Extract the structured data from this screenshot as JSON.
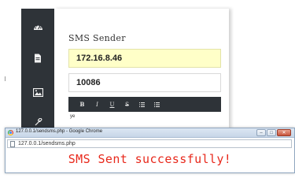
{
  "sidebar": {
    "items": [
      {
        "icon": "dashboard-icon"
      },
      {
        "icon": "document-icon"
      },
      {
        "icon": "image-icon"
      },
      {
        "icon": "link-icon"
      }
    ]
  },
  "form": {
    "title": "SMS Sender",
    "ip_value": "172.16.8.46",
    "phone_value": "10086",
    "editor_text": "ye"
  },
  "editor_toolbar": {
    "buttons": [
      {
        "label": "B",
        "icon": "bold-icon"
      },
      {
        "label": "I",
        "icon": "italic-icon"
      },
      {
        "label": "U",
        "icon": "underline-icon"
      },
      {
        "label": "S",
        "icon": "strikethrough-icon"
      },
      {
        "label": "",
        "icon": "unordered-list-icon"
      },
      {
        "label": "",
        "icon": "ordered-list-icon"
      }
    ]
  },
  "popup": {
    "window_title": "127.0.0.1/sendsms.php - Google Chrome",
    "url": "127.0.0.1/sendsms.php",
    "message": "SMS Sent successfully!",
    "message_color": "#e8291c",
    "window_buttons": [
      {
        "icon": "minimize-icon",
        "glyph": "–"
      },
      {
        "icon": "maximize-icon",
        "glyph": "□"
      },
      {
        "icon": "close-icon",
        "glyph": "✕"
      }
    ]
  },
  "colors": {
    "sidebar_bg": "#2e3338",
    "ip_field_bg": "#ffffc8"
  }
}
